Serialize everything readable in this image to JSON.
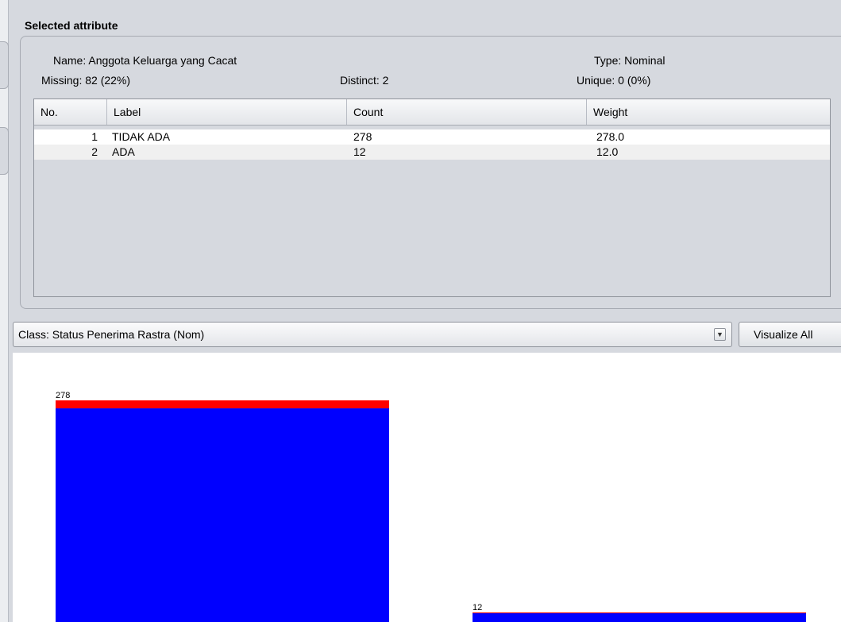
{
  "selected_attribute": {
    "title": "Selected attribute",
    "name_label": "Name: Anggota Keluarga yang Cacat",
    "type_label": "Type: Nominal",
    "missing_label": "Missing: 82 (22%)",
    "distinct_label": "Distinct: 2",
    "unique_label": "Unique: 0 (0%)"
  },
  "table": {
    "columns": [
      "No.",
      "Label",
      "Count",
      "Weight"
    ],
    "rows": [
      {
        "no": "1",
        "label": "TIDAK ADA",
        "count": "278",
        "weight": "278.0"
      },
      {
        "no": "2",
        "label": "ADA",
        "count": "12",
        "weight": "12.0"
      }
    ]
  },
  "class_select": {
    "value": "Class: Status Penerima Rastra  (Nom)",
    "arrow_icon": "triangle-down-icon"
  },
  "visualize_all_label": "Visualize All",
  "colors": {
    "class_blue": "#0000ff",
    "class_red": "#ff0000"
  },
  "chart_data": {
    "type": "bar",
    "categories": [
      "TIDAK ADA",
      "ADA"
    ],
    "values": [
      278,
      12
    ],
    "value_labels": [
      "278",
      "12"
    ],
    "series": [
      {
        "name": "",
        "color": "#0000ff",
        "values": [
          268,
          11
        ]
      },
      {
        "name": "",
        "color": "#ff0000",
        "values": [
          10,
          1
        ]
      }
    ],
    "ylim": [
      0,
      278
    ],
    "grid": false,
    "legend": "none"
  }
}
